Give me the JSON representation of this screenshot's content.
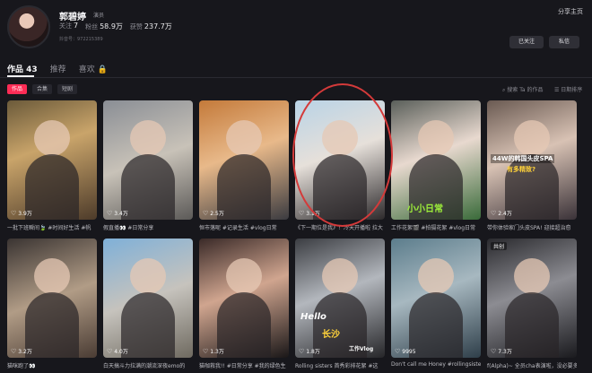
{
  "profile": {
    "name": "郭碧婷",
    "badge": "演员",
    "stats": [
      {
        "label": "关注",
        "value": "7"
      },
      {
        "label": "粉丝",
        "value": "58.9万"
      },
      {
        "label": "获赞",
        "value": "237.7万"
      }
    ],
    "uid": "抖音号：972215389",
    "share": "分享主页",
    "follow_button": "已关注",
    "message_button": "私信"
  },
  "tabs": [
    {
      "label": "作品 43"
    },
    {
      "label": "推荐"
    },
    {
      "label": "喜欢 🔒"
    }
  ],
  "filters": [
    "作品",
    "合集",
    "短剧"
  ],
  "search_placeholder": "搜索 Ta 的作品",
  "sort_label": "日期排序",
  "cards": [
    {
      "likes": "3.9万",
      "caption": "一批下班瞬间🍃 #时间好生活 #帆",
      "bg": "linear-gradient(160deg,#6b5a3a,#c9a46a 40%,#4d3b2a)"
    },
    {
      "likes": "3.4万",
      "caption": "假直播👀 #日常分享",
      "bg": "linear-gradient(160deg,#8a8e95,#c8c2b8 50%,#5c5a58)"
    },
    {
      "likes": "2.5万",
      "caption": "恒市落呢 #记录生活 #vlog日常",
      "bg": "linear-gradient(160deg,#c47a3a,#e8b98a 45%,#3b3b40)"
    },
    {
      "likes": "3.1万",
      "caption": "《下一期位是我》！冷天开播啦 拉大",
      "bg": "linear-gradient(160deg,#b9d3e6,#e6e0da 45%,#2d2a2c)"
    },
    {
      "likes": "",
      "caption": "工作花絮🎬 #拍摄花絮 #vlog日常",
      "bg": "linear-gradient(160deg,#5a5f5a,#e8d9cf 45%,#3a6b3a)"
    },
    {
      "likes": "2.4万",
      "caption": "带你体验家门头皮SPA! 迎接超治愈",
      "bg": "linear-gradient(160deg,#6a5a52,#d8c2b4 45%,#3a3238)"
    },
    {
      "likes": "3.2万",
      "caption": "猫咪跑了👀",
      "bg": "linear-gradient(160deg,#3a3432,#b19c86 50%,#4a3c34)"
    },
    {
      "likes": "4.0万",
      "caption": "白天搞斗力拉满的潮流深夜emo的",
      "bg": "linear-gradient(160deg,#7fb0d8,#c6c3bd 50%,#6f6a60)"
    },
    {
      "likes": "1.3万",
      "caption": "猫咖救我!! #日常分享 #我的绿色生",
      "bg": "linear-gradient(160deg,#3a2a28,#d0a58f 45%,#1a1718)"
    },
    {
      "likes": "1.8万",
      "caption": "Rolling sisters 首秀彩排花絮 #这",
      "bg": "linear-gradient(160deg,#3b3d42,#b3b7bd 45%,#262629)"
    },
    {
      "likes": "9995",
      "caption": "Don't call me Honey #rollingsisters",
      "bg": "linear-gradient(160deg,#5c7d8c,#a7b8c0 45%,#2f3f4a)"
    },
    {
      "likes": "7.3万",
      "caption": "f(Alpha)~ 全员cha表演啦，没必要多",
      "bg": "linear-gradient(160deg,#2a2a2e,#8c8c92 45%,#1a1a1e)"
    }
  ],
  "overlays": {
    "card6": "44W的韩国头皮SPA",
    "card6b": "有多精致?",
    "card5": "小小日常",
    "card10a": "Hello",
    "card10b": "长沙",
    "card10c": "工作Vlog",
    "card12_pin": "共创"
  }
}
